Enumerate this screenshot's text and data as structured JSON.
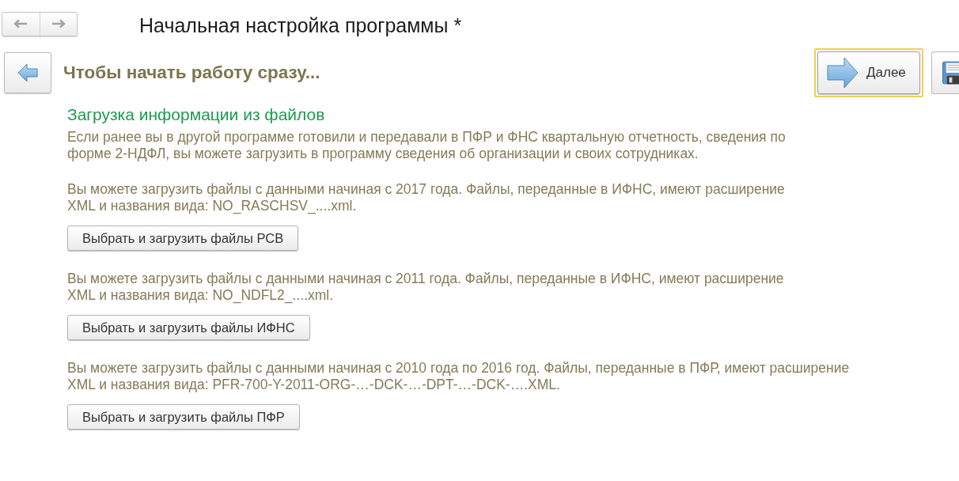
{
  "window": {
    "title": "Начальная настройка программы *"
  },
  "header": {
    "title": "Чтобы начать работу сразу..."
  },
  "actions": [
    {
      "kind": "next",
      "label": "Далее",
      "focused": true
    },
    {
      "kind": "save",
      "focused": false
    }
  ],
  "section": {
    "heading": "Загрузка информации из файлов",
    "intro": "Если ранее вы в другой программе готовили и передавали в ПФР и ФНС квартальную отчетность, сведения по\nформе 2-НДФЛ, вы можете загрузить в программу сведения об организации и своих сотрудниках.",
    "imports": [
      {
        "note": "Вы можете загрузить файлы с данными начиная с 2017 года. Файлы, переданные в ИФНС, имеют расширение\nXML и названия вида: NO_RASCHSV_....xml.",
        "button": "Выбрать и загрузить файлы РСВ"
      },
      {
        "note": "Вы можете загрузить файлы с данными начиная с 2011 года. Файлы, переданные в ИФНС, имеют расширение\nXML и названия вида: NO_NDFL2_....xml.",
        "button": "Выбрать и загрузить файлы ИФНС"
      },
      {
        "note": "Вы можете загрузить файлы с данными начиная с 2010 года по 2016 год. Файлы, переданные в ПФР, имеют расширение\nXML и названия вида: PFR-700-Y-2011-ORG-…-DCK-…-DPT-…-DCK-….XML.",
        "button": "Выбрать и загрузить файлы ПФР"
      }
    ]
  }
}
